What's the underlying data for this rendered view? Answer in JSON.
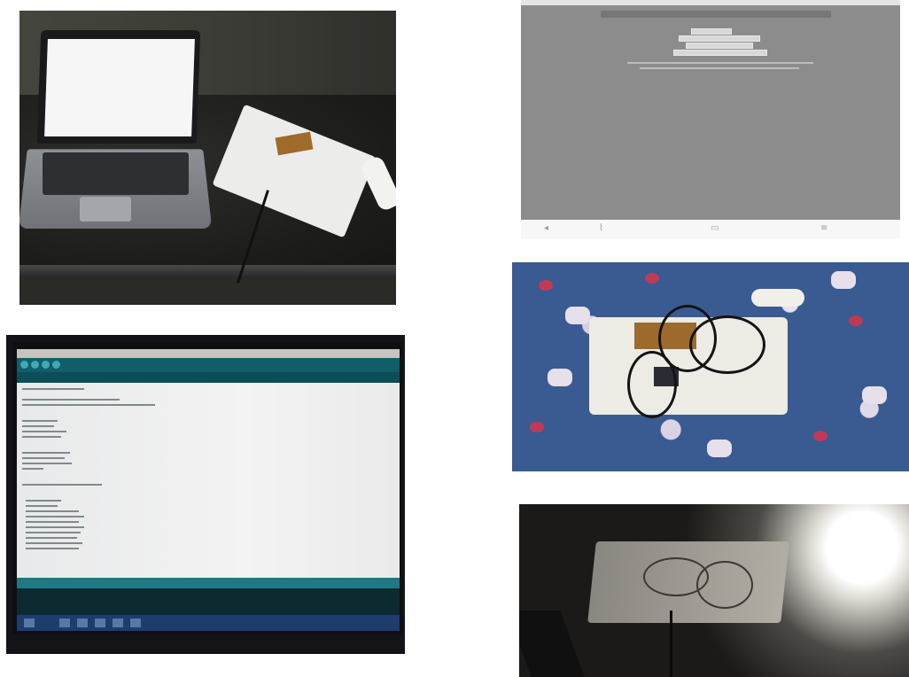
{
  "figure": {
    "panels": [
      {
        "id": "laptop-setup"
      },
      {
        "id": "mobile-app-screenshot"
      },
      {
        "id": "arduino-code-screen"
      },
      {
        "id": "board-on-cloth"
      },
      {
        "id": "board-with-lit-bulb"
      }
    ]
  }
}
